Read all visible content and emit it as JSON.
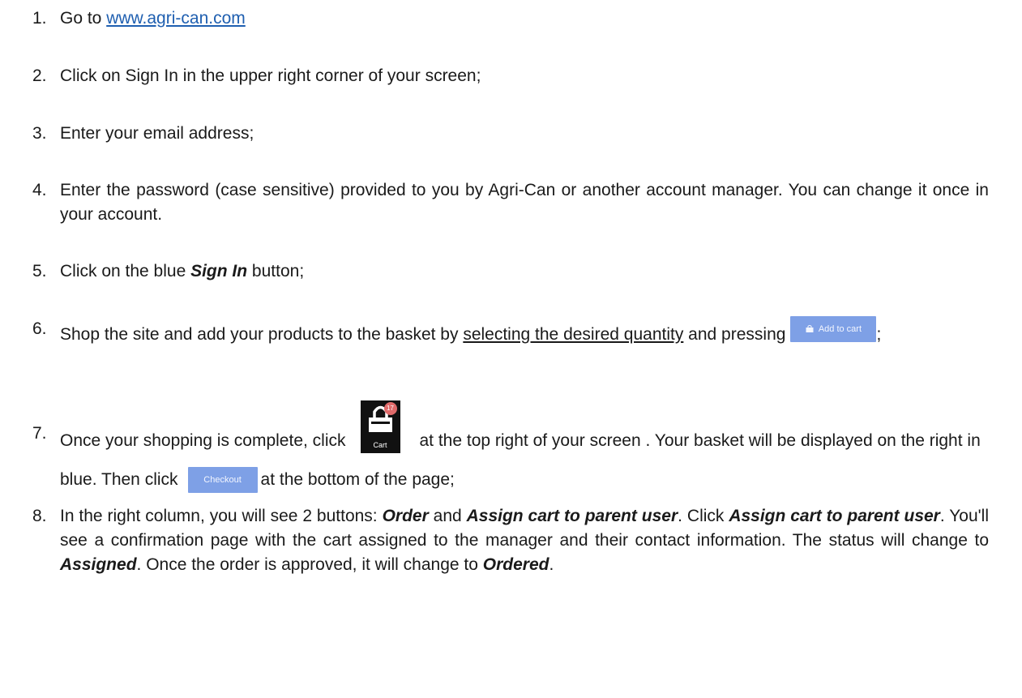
{
  "steps": [
    {
      "num": "1.",
      "prefix": "Go to ",
      "link": "www.agri-can.com"
    },
    {
      "num": "2.",
      "text": "Click on Sign In in the upper right corner of your screen;"
    },
    {
      "num": "3.",
      "text": "Enter your email address;"
    },
    {
      "num": "4.",
      "text": "Enter the password (case sensitive) provided to you by Agri-Can or another account manager. You can change it once in your account."
    },
    {
      "num": "5.",
      "pre": "Click on the blue ",
      "em": "Sign In",
      "post": " button;"
    },
    {
      "num": "6.",
      "pre": "Shop the site and add your products to the basket by ",
      "u": "selecting the desired quantity",
      "post": " and pressing",
      "btn": "Add to cart",
      "end": ";"
    },
    {
      "num": "7.",
      "pre": "Once your shopping is complete, click",
      "cart_label": "Cart",
      "cart_badge": "17",
      "mid": "at the top right of your screen . Your basket will be displayed on the right in blue. Then click",
      "btn": "Checkout",
      "post": "at the bottom of the page;"
    },
    {
      "num": "8.",
      "t1": "In the right column, you will see 2 buttons: ",
      "b1": "Order",
      "t2": " and ",
      "b2": "Assign cart to parent user",
      "t3": ". Click ",
      "b3": "Assign cart to parent user",
      "t4": ". You'll see a confirmation page with the cart assigned to the manager and their contact information. The status will change to ",
      "b4": "Assigned",
      "t5": ". Once the order is approved, it will change to ",
      "b5": "Ordered",
      "t6": "."
    }
  ],
  "colors": {
    "link": "#1f5fb0",
    "button": "#7ea0e6",
    "cart_bg": "#111111",
    "badge": "#e06a6a"
  }
}
